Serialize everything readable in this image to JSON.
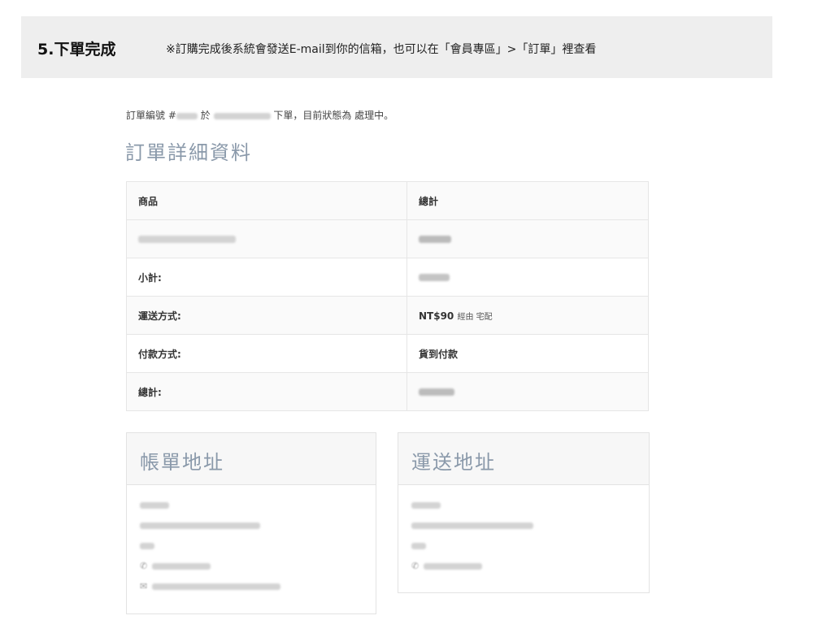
{
  "banner": {
    "step_title": "5.下單完成",
    "note": "※訂購完成後系統會發送E-mail到你的信箱，也可以在「會員專區」>「訂單」裡查看"
  },
  "intro": {
    "prefix": "訂單編號 #",
    "at": " 於 ",
    "suffix": " 下單，目前狀態為 ",
    "status": "處理中",
    "end": "。"
  },
  "details": {
    "title": "訂單詳細資料",
    "head_product": "商品",
    "head_total": "總計",
    "rows": [
      {
        "label": "小計:",
        "value": ""
      },
      {
        "label": "運送方式:",
        "value": "NT$90",
        "extra": "經由 宅配"
      },
      {
        "label": "付款方式:",
        "value": "貨到付款"
      },
      {
        "label": "總計:",
        "value": ""
      }
    ]
  },
  "billing": {
    "title": "帳單地址"
  },
  "shipping": {
    "title": "運送地址"
  },
  "icons": {
    "phone": "phone-icon",
    "email": "email-icon"
  }
}
